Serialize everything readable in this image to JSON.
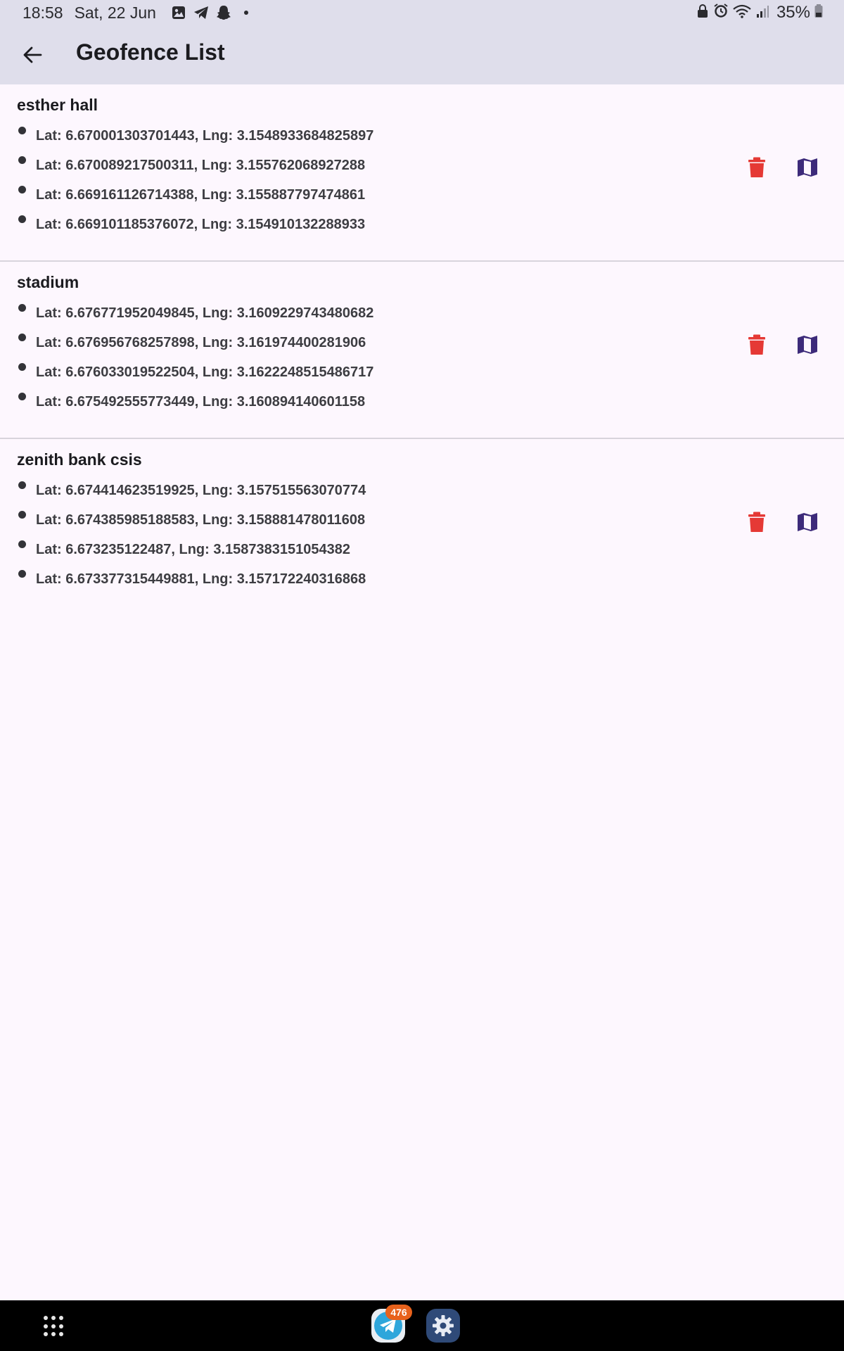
{
  "status_bar": {
    "time": "18:58",
    "date": "Sat, 22 Jun",
    "battery_text": "35%",
    "left_icons": [
      "gallery-icon",
      "telegram-icon",
      "snapchat-icon",
      "dot-icon"
    ],
    "right_icons": [
      "lock-icon",
      "alarm-icon",
      "wifi-icon",
      "signal-icon",
      "battery-icon"
    ]
  },
  "app_bar": {
    "title": "Geofence List",
    "back_icon": "arrow-back-icon"
  },
  "geofences": [
    {
      "name": "esther hall",
      "points": [
        "Lat: 6.670001303701443, Lng: 3.1548933684825897",
        "Lat: 6.670089217500311, Lng: 3.155762068927288",
        "Lat: 6.669161126714388, Lng: 3.155887797474861",
        "Lat: 6.669101185376072, Lng: 3.154910132288933"
      ]
    },
    {
      "name": "stadium",
      "points": [
        "Lat: 6.676771952049845, Lng: 3.1609229743480682",
        "Lat: 6.676956768257898, Lng: 3.161974400281906",
        "Lat: 6.676033019522504, Lng: 3.1622248515486717",
        "Lat: 6.675492555773449, Lng: 3.160894140601158"
      ]
    },
    {
      "name": "zenith bank csis",
      "points": [
        "Lat: 6.674414623519925, Lng: 3.157515563070774",
        "Lat: 6.674385985188583, Lng: 3.158881478011608",
        "Lat: 6.673235122487, Lng: 3.1587383151054382",
        "Lat: 6.673377315449881, Lng: 3.157172240316868"
      ]
    }
  ],
  "colors": {
    "delete": "#e53935",
    "map": "#3d2b7a",
    "app_bar_bg": "#dfdeeb",
    "page_bg": "#fdf7fe"
  },
  "nav_bar": {
    "telegram_badge": "476"
  }
}
